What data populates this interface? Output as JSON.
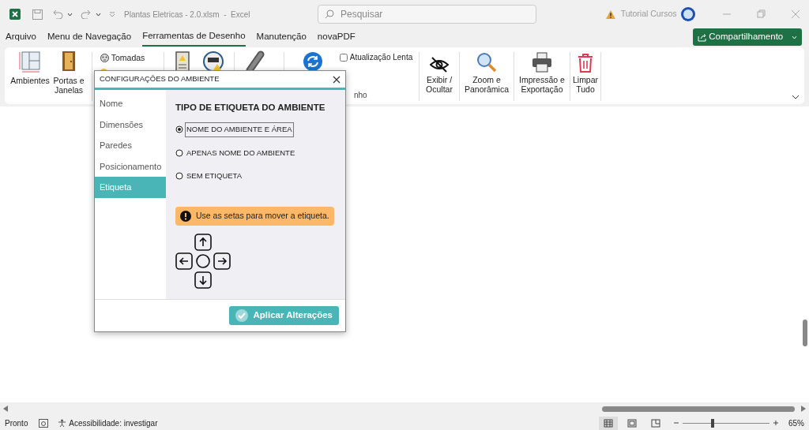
{
  "window": {
    "title": "Plantas Eletricas - 2.0.xlsm  -  Excel",
    "search_placeholder": "Pesquisar",
    "user": "Tutorial Cursos"
  },
  "menu_tabs": [
    {
      "label": "Arquivo",
      "selected": false
    },
    {
      "label": "Menu de Navegação",
      "selected": false
    },
    {
      "label": "Ferramentas de Desenho",
      "selected": true
    },
    {
      "label": "Manutenção",
      "selected": false
    },
    {
      "label": "novaPDF",
      "selected": false
    }
  ],
  "share_button": "Compartilhamento",
  "ribbon": {
    "left_items": [
      {
        "label": "Ambientes"
      },
      {
        "label": "Portas e Janelas"
      }
    ],
    "small_items": [
      {
        "label": "Tomadas"
      }
    ],
    "slow_update": {
      "label": "Atualização Lenta",
      "checked": false
    },
    "group_label": "nho",
    "right_items": [
      {
        "label": "Exibir / Ocultar"
      },
      {
        "label": "Zoom e Panorâmica"
      },
      {
        "label": "Impressão e Exportação"
      },
      {
        "label": "Limpar Tudo"
      }
    ]
  },
  "dialog": {
    "title": "CONFIGURAÇÕES DO AMBIENTE",
    "nav": [
      {
        "label": "Nome",
        "selected": false
      },
      {
        "label": "Dimensões",
        "selected": false
      },
      {
        "label": "Paredes",
        "selected": false
      },
      {
        "label": "Posicionamento",
        "selected": false
      },
      {
        "label": "Etiqueta",
        "selected": true
      }
    ],
    "heading": "TIPO DE ETIQUETA DO AMBIENTE",
    "options": [
      {
        "label": "NOME DO AMBIENTE E ÁREA",
        "selected": true
      },
      {
        "label": "APENAS NOME DO AMBIENTE",
        "selected": false
      },
      {
        "label": "SEM ETIQUETA",
        "selected": false
      }
    ],
    "notice": "Use as setas para mover a etiqueta.",
    "apply_button": "Aplicar Alterações"
  },
  "status_bar": {
    "status": "Pronto",
    "accessibility": "Acessibilidade: investigar",
    "views": [
      {
        "selected": true
      },
      {
        "selected": false
      },
      {
        "selected": false
      }
    ],
    "zoom": {
      "level": 0.35,
      "reading": "65%"
    }
  }
}
